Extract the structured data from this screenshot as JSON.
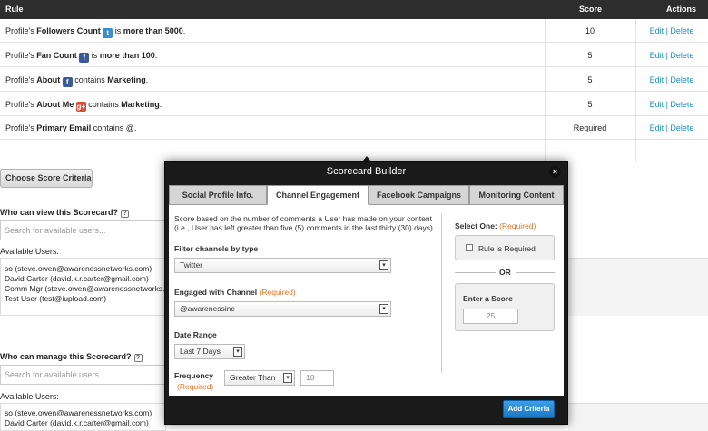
{
  "table": {
    "headers": {
      "rule": "Rule",
      "score": "Score",
      "actions": "Actions"
    },
    "rows": [
      {
        "prefix": "Profile's ",
        "bold": "Followers Count",
        "icon": "twitter-icon",
        "icon_glyph": "t",
        "mid": " is ",
        "bold2": "more than 5000",
        "suffix": ".",
        "score": "10",
        "edit": "Edit",
        "sep": " | ",
        "delete": "Delete"
      },
      {
        "prefix": "Profile's ",
        "bold": "Fan Count",
        "icon": "facebook-icon",
        "icon_glyph": "f",
        "mid": " is ",
        "bold2": "more than 100",
        "suffix": ".",
        "score": "5",
        "edit": "Edit",
        "sep": " | ",
        "delete": "Delete"
      },
      {
        "prefix": "Profile's ",
        "bold": "About",
        "icon": "facebook-icon",
        "icon_glyph": "f",
        "mid": " contains ",
        "bold2": "Marketing",
        "suffix": ".",
        "score": "5",
        "edit": "Edit",
        "sep": " | ",
        "delete": "Delete"
      },
      {
        "prefix": "Profile's ",
        "bold": "About Me",
        "icon": "google-plus-icon",
        "icon_glyph": "g+",
        "mid": " contains ",
        "bold2": "Marketing",
        "suffix": ".",
        "score": "5",
        "edit": "Edit",
        "sep": " | ",
        "delete": "Delete"
      },
      {
        "prefix": "Profile's ",
        "bold": "Primary Email",
        "mid": " contains @.",
        "score": "Required",
        "edit": "Edit",
        "sep": " | ",
        "delete": "Delete"
      }
    ]
  },
  "form": {
    "choose_button": "Choose Score Criteria",
    "view_label": "Who can view this Scorecard?",
    "view_search_placeholder": "Search for available users...",
    "available_users_label": "Available Users:",
    "view_users": [
      "so (steve.owen@awarenessnetworks.com)",
      "David Carter (david.k.r.carter@gmail.com)",
      "Comm Mgr (steve.owen@awarenessnetworks.com)",
      "Test User (test@iupload.com)"
    ],
    "manage_label": "Who can manage this Scorecard?",
    "manage_search_placeholder": "Search for available users...",
    "manage_available_label": "Available Users:",
    "manage_users": [
      "so (steve.owen@awarenessnetworks.com)",
      "David Carter (david.k.r.carter@gmail.com)"
    ]
  },
  "modal": {
    "title": "Scorecard Builder",
    "close": "×",
    "tabs": [
      "Social Profile Info.",
      "Channel Engagement",
      "Facebook Campaigns",
      "Monitoring Content"
    ],
    "active_tab": "Channel Engagement",
    "description_line1": "Score based on the number of comments a User has made on your content",
    "description_line2": "(i.e., User has left greater than five (5) comments in the last thirty (30) days)",
    "filter_label": "Filter channels by type",
    "filter_value": "Twitter",
    "engaged_label": "Engaged with Channel",
    "engaged_required": "(Required)",
    "engaged_value": "@awarenessinc",
    "date_label": "Date Range",
    "date_value": "Last 7 Days",
    "frequency_label": "Frequency",
    "frequency_required": "(Required)",
    "frequency_operator": "Greater Than",
    "frequency_value": "10",
    "select_one_label": "Select One:",
    "select_one_required": "(Required)",
    "rule_required_label": "Rule is Required",
    "or_label": "OR",
    "enter_score_label": "Enter a Score",
    "score_value": "25",
    "add_button": "Add Criteria"
  }
}
